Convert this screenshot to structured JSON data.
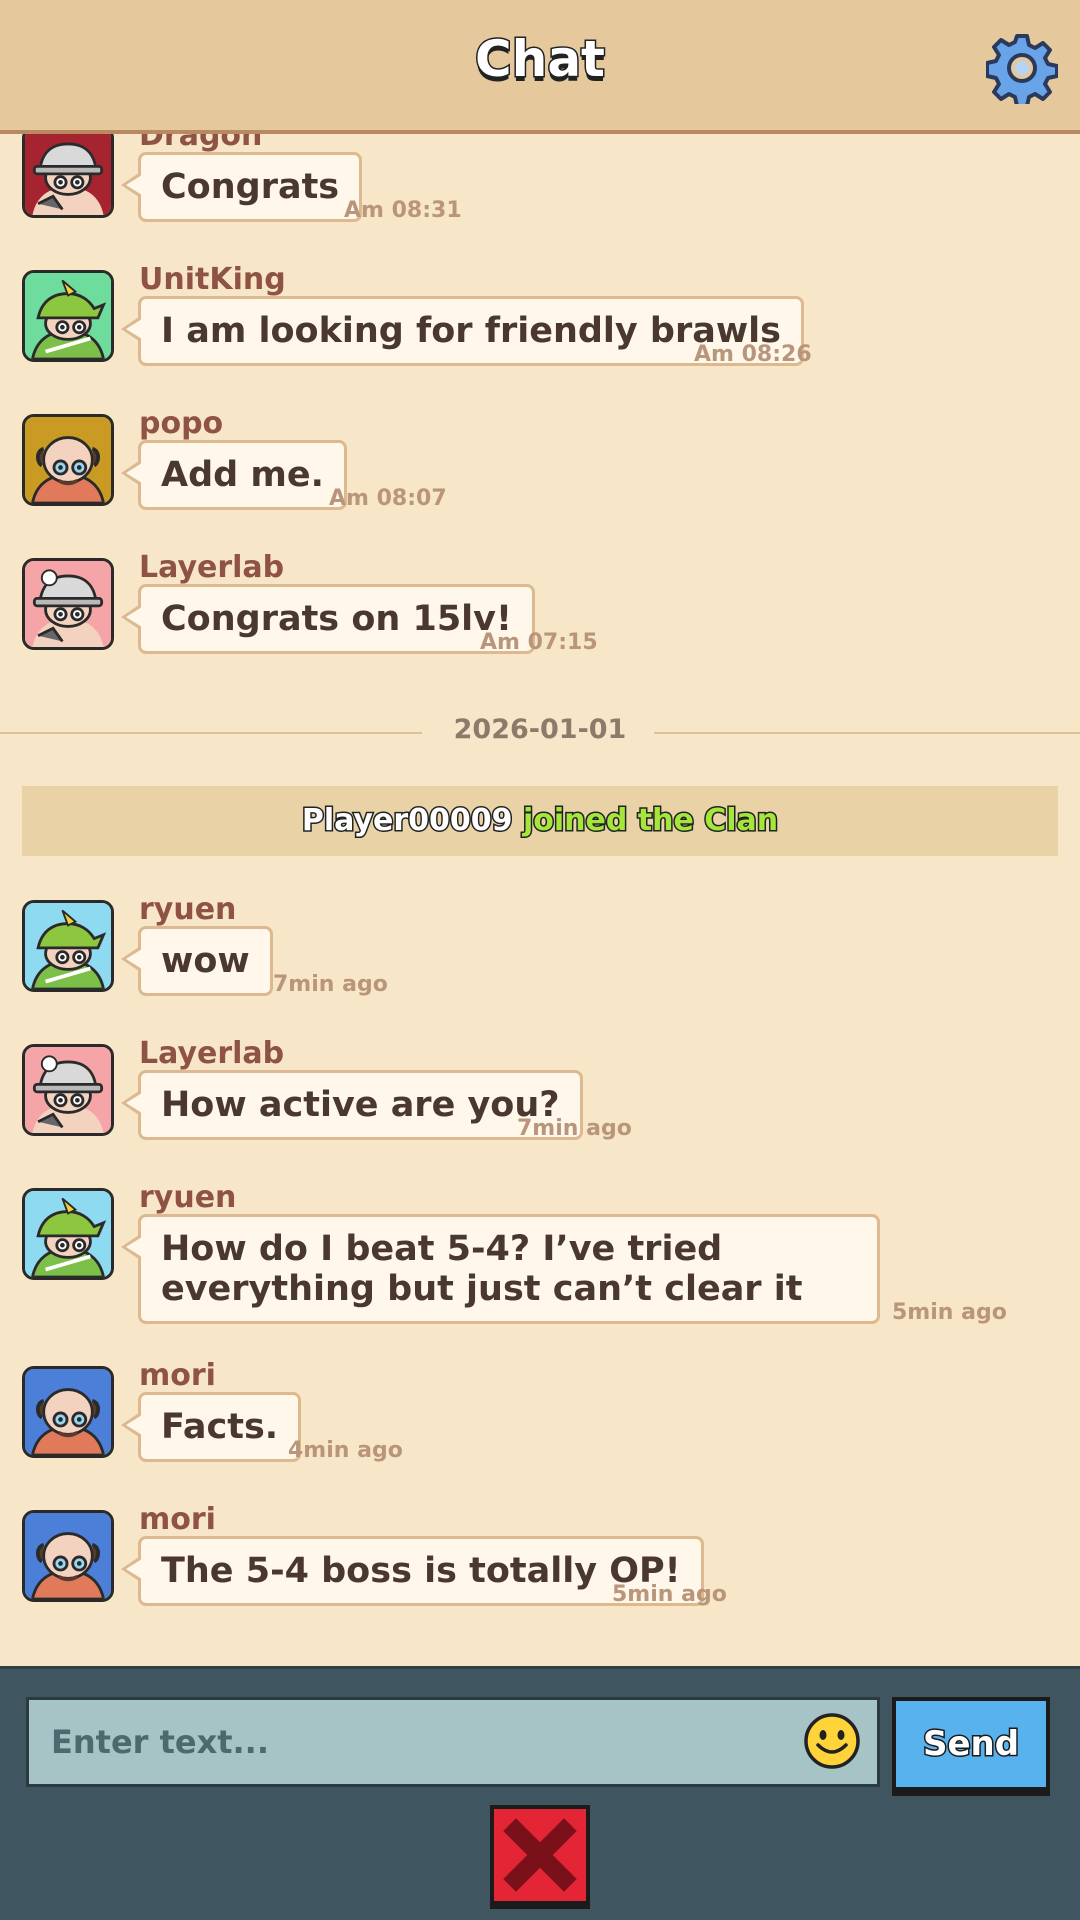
{
  "header": {
    "title": "Chat",
    "settings_icon": "gear-icon"
  },
  "messages_before": [
    {
      "sender": "Dragon",
      "text": "Congrats",
      "time": "Am 08:31",
      "avatar": "knight-avatar",
      "avatar_bg": "#a5242f"
    },
    {
      "sender": "UnitKing",
      "text": "I am looking for friendly brawls",
      "time": "Am 08:26",
      "avatar": "archer-avatar",
      "avatar_bg": "#6edc9c"
    },
    {
      "sender": "popo",
      "text": "Add me.",
      "time": "Am 08:07",
      "avatar": "bald-avatar",
      "avatar_bg": "#c99b22"
    },
    {
      "sender": "Layerlab",
      "text": "Congrats on 15lv!",
      "time": "Am 07:15",
      "avatar": "knight-avatar",
      "avatar_bg": "#f5a5a8"
    }
  ],
  "date_separator": "2026-01-01",
  "system_message": {
    "player": "Player00009",
    "action": "joined the Clan"
  },
  "messages_after": [
    {
      "sender": "ryuen",
      "text": "wow",
      "time": "7min ago",
      "avatar": "archer-avatar",
      "avatar_bg": "#8edaf0"
    },
    {
      "sender": "Layerlab",
      "text": "How active are you?",
      "time": "7min ago",
      "avatar": "knight-avatar",
      "avatar_bg": "#f5a5a8"
    },
    {
      "sender": "ryuen",
      "text": "How do I beat 5-4? I’ve tried everything but just can’t clear it",
      "time": "5min ago",
      "avatar": "archer-avatar",
      "avatar_bg": "#8edaf0"
    },
    {
      "sender": "mori",
      "text": "Facts.",
      "time": "4min ago",
      "avatar": "bald-avatar",
      "avatar_bg": "#4b7fd8"
    },
    {
      "sender": "mori",
      "text": "The 5-4 boss is totally OP!",
      "time": "5min ago",
      "avatar": "bald-avatar",
      "avatar_bg": "#4b7fd8"
    }
  ],
  "input": {
    "placeholder": "Enter text...",
    "value": ""
  },
  "buttons": {
    "send": "Send",
    "emoji_icon": "smiley-icon",
    "close_icon": "close-x-icon"
  }
}
